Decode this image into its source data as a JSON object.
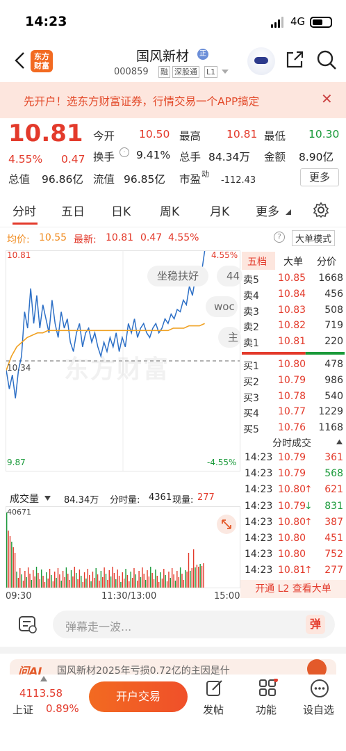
{
  "status": {
    "time": "14:23",
    "network": "4G",
    "battery_pct": 0.6
  },
  "header": {
    "logo_line1": "东方",
    "logo_line2": "财富",
    "stock_name": "国风新材",
    "name_badge": "正",
    "code": "000859",
    "tags": [
      "融",
      "深股通",
      "L1"
    ]
  },
  "banner": {
    "text": "先开户！选东方财富证券，行情交易一个APP搞定",
    "close": "✕"
  },
  "quote": {
    "price": "10.81",
    "change_pct": "4.55%",
    "change": "0.47",
    "open_label": "今开",
    "open": "10.50",
    "high_label": "最高",
    "high": "10.81",
    "low_label": "最低",
    "low": "10.30",
    "turnover_label": "换手",
    "turnover": "9.41%",
    "volume_label": "总手",
    "volume": "84.34万",
    "amount_label": "金额",
    "amount": "8.90亿",
    "mcap_label": "总值",
    "mcap": "96.86亿",
    "float_label": "流值",
    "float": "96.85亿",
    "pe_label": "市盈",
    "pe_sup": "动",
    "pe": "-112.43",
    "more_label": "更多"
  },
  "tabs": [
    "分时",
    "五日",
    "日K",
    "周K",
    "月K",
    "更多"
  ],
  "avg_bar": {
    "avg_label": "均价:",
    "avg": "10.55",
    "latest_label": "最新:",
    "latest": "10.81",
    "chg": "0.47",
    "pct": "4.55%",
    "mode": "大单模式"
  },
  "chart": {
    "top_price": "10.81",
    "bottom_price": "9.87",
    "top_pct": "4.55%",
    "bottom_pct": "-4.55%",
    "mid_price": "10.34",
    "x_start": "09:30",
    "x_mid": "11:30/13:00",
    "x_end": "15:00",
    "watermark": "东方财富",
    "price_line": [
      10.3,
      10.22,
      10.28,
      10.18,
      10.3,
      10.36,
      10.55,
      10.48,
      10.65,
      10.5,
      10.62,
      10.48,
      10.58,
      10.52,
      10.46,
      10.6,
      10.5,
      10.44,
      10.55,
      10.48,
      10.52,
      10.42,
      10.38,
      10.46,
      10.5,
      10.4,
      10.46,
      10.48,
      10.42,
      10.46,
      10.4,
      10.36,
      10.42,
      10.38,
      10.44,
      10.4,
      10.46,
      10.38,
      10.44,
      10.4,
      10.5,
      10.46,
      10.52,
      10.44,
      10.48,
      10.5,
      10.46,
      10.44,
      10.48,
      10.5,
      10.46,
      10.48,
      10.52,
      10.5,
      10.54,
      10.52,
      10.56,
      10.55,
      10.6,
      10.58,
      10.66,
      10.62,
      10.7,
      10.74,
      10.72,
      10.81
    ],
    "avg_line": [
      10.3,
      10.36,
      10.4,
      10.42,
      10.44,
      10.45,
      10.46,
      10.46,
      10.47,
      10.47,
      10.47,
      10.47,
      10.47,
      10.47,
      10.47,
      10.47,
      10.47,
      10.47,
      10.47,
      10.47,
      10.47,
      10.47,
      10.47,
      10.47,
      10.47,
      10.47,
      10.47,
      10.47,
      10.47,
      10.47,
      10.47,
      10.47,
      10.48,
      10.48,
      10.48,
      10.49,
      10.49,
      10.49,
      10.5
    ]
  },
  "danmu": [
    "坐稳扶好",
    "44",
    "woc",
    "主"
  ],
  "volume_bar": {
    "label": "成交量",
    "total": "84.34万",
    "tick_label": "分时量:",
    "tick": "4361",
    "now_label": "现量:",
    "now": "277",
    "max": "40671"
  },
  "orderbook": {
    "tabs": [
      "五档",
      "大单",
      "分价"
    ],
    "asks": [
      {
        "label": "卖5",
        "price": "10.85",
        "vol": "1668"
      },
      {
        "label": "卖4",
        "price": "10.84",
        "vol": "456"
      },
      {
        "label": "卖3",
        "price": "10.83",
        "vol": "508"
      },
      {
        "label": "卖2",
        "price": "10.82",
        "vol": "719"
      },
      {
        "label": "卖1",
        "price": "10.81",
        "vol": "220"
      }
    ],
    "bids": [
      {
        "label": "买1",
        "price": "10.80",
        "vol": "478"
      },
      {
        "label": "买2",
        "price": "10.79",
        "vol": "986"
      },
      {
        "label": "买3",
        "price": "10.78",
        "vol": "540"
      },
      {
        "label": "买4",
        "price": "10.77",
        "vol": "1229"
      },
      {
        "label": "买5",
        "price": "10.76",
        "vol": "1168"
      }
    ],
    "ask_fraction": 0.62
  },
  "trades": {
    "title": "分时成交",
    "rows": [
      {
        "time": "14:23",
        "price": "10.79",
        "arrow": "",
        "vol": "361",
        "c": "red"
      },
      {
        "time": "14:23",
        "price": "10.79",
        "arrow": "",
        "vol": "568",
        "c": "green"
      },
      {
        "time": "14:23",
        "price": "10.80",
        "arrow": "↑",
        "vol": "621",
        "c": "red"
      },
      {
        "time": "14:23",
        "price": "10.79",
        "arrow": "↓",
        "vol": "831",
        "c": "green"
      },
      {
        "time": "14:23",
        "price": "10.80",
        "arrow": "↑",
        "vol": "387",
        "c": "red"
      },
      {
        "time": "14:23",
        "price": "10.80",
        "arrow": "",
        "vol": "451",
        "c": "red"
      },
      {
        "time": "14:23",
        "price": "10.80",
        "arrow": "",
        "vol": "752",
        "c": "red"
      },
      {
        "time": "14:23",
        "price": "10.81",
        "arrow": "↑",
        "vol": "277",
        "c": "red"
      }
    ],
    "l2": "开通 L2 查看大单"
  },
  "comment": {
    "placeholder": "弹幕走一波...",
    "danmu_btn": "弹"
  },
  "ai_strip": {
    "badge": "问AI",
    "text": "国风新材2025年亏损0.72亿的主因是什"
  },
  "bottom": {
    "index_value": "4113.58",
    "index_name": "上证",
    "index_pct": "0.89%",
    "trade_btn": "开户交易",
    "post": "发帖",
    "func": "功能",
    "settings": "设自选"
  },
  "colors": {
    "up": "#e33a2b",
    "down": "#1a9a3a",
    "avg": "#f0a020",
    "price": "#2c6fc6",
    "brand": "#f26a21"
  }
}
